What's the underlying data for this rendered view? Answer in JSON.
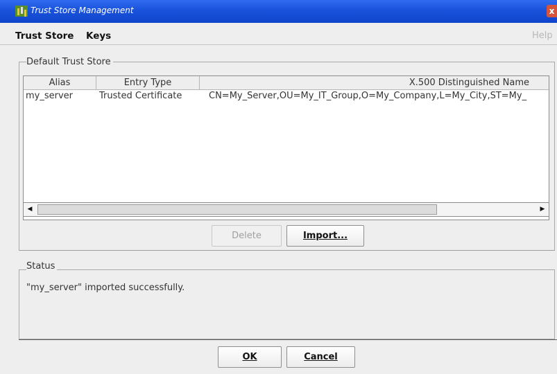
{
  "window": {
    "title": "Trust Store Management",
    "close_glyph": "x"
  },
  "menu": {
    "items": [
      "Trust Store",
      "Keys"
    ],
    "help": "Help"
  },
  "trust_store_panel": {
    "label": "Default Trust Store",
    "columns": [
      "Alias",
      "Entry Type",
      "X.500 Distinguished Name"
    ],
    "rows": [
      [
        "my_server",
        "Trusted Certificate",
        "CN=My_Server,OU=My_IT_Group,O=My_Company,L=My_City,ST=My_"
      ]
    ]
  },
  "buttons": {
    "delete": "Delete",
    "import": "Import...",
    "ok": "OK",
    "cancel": "Cancel"
  },
  "status_panel": {
    "label": "Status",
    "message": "\"my_server\" imported successfully."
  },
  "colors": {
    "titlebar": "#1a52db",
    "close": "#d5543a",
    "background": "#eeeeee"
  }
}
